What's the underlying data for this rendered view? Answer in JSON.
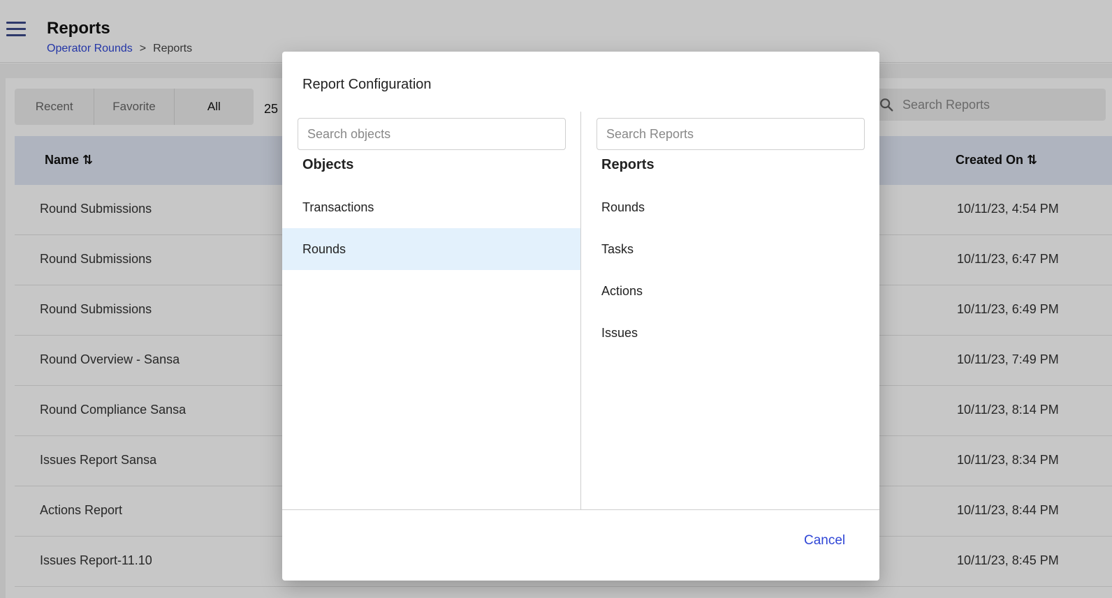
{
  "header": {
    "title": "Reports",
    "breadcrumb": {
      "parent": "Operator Rounds",
      "separator": ">",
      "current": "Reports"
    }
  },
  "filters": {
    "tabs": [
      "Recent",
      "Favorite",
      "All"
    ],
    "count": "25"
  },
  "search": {
    "placeholder": "Search Reports"
  },
  "table": {
    "columns": {
      "name": "Name ⇅",
      "created_on": "Created On ⇅"
    },
    "rows": [
      {
        "name": "Round Submissions",
        "created_on": "10/11/23, 4:54 PM"
      },
      {
        "name": "Round Submissions",
        "created_on": "10/11/23, 6:47 PM"
      },
      {
        "name": "Round Submissions",
        "created_on": "10/11/23, 6:49 PM"
      },
      {
        "name": "Round Overview - Sansa",
        "created_on": "10/11/23, 7:49 PM"
      },
      {
        "name": "Round Compliance Sansa",
        "created_on": "10/11/23, 8:14 PM"
      },
      {
        "name": "Issues Report Sansa",
        "created_on": "10/11/23, 8:34 PM"
      },
      {
        "name": "Actions Report",
        "created_on": "10/11/23, 8:44 PM"
      },
      {
        "name": "Issues Report-11.10",
        "created_on": "10/11/23, 8:45 PM"
      }
    ]
  },
  "modal": {
    "title": "Report Configuration",
    "objects": {
      "search_placeholder": "Search objects",
      "heading": "Objects",
      "items": [
        "Transactions",
        "Rounds"
      ],
      "selected": "Rounds"
    },
    "reports": {
      "search_placeholder": "Search Reports",
      "heading": "Reports",
      "items": [
        "Rounds",
        "Tasks",
        "Actions",
        "Issues"
      ]
    },
    "cancel_label": "Cancel"
  },
  "icons": {
    "menu": "hamburger-icon",
    "search": "search-icon"
  },
  "colors": {
    "accent": "#2f46d6",
    "selected_row": "#e3f1fc",
    "table_header": "#e1e7f5"
  }
}
